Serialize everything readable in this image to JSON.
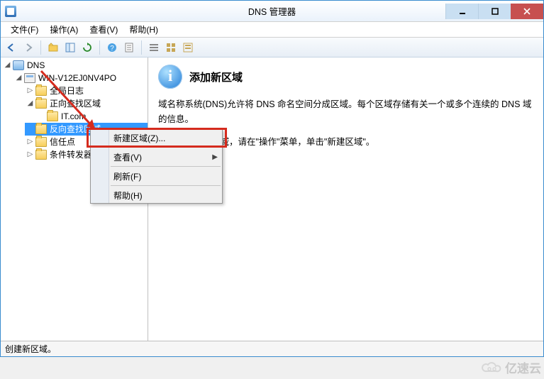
{
  "window": {
    "title": "DNS 管理器"
  },
  "menubar": {
    "file": "文件(F)",
    "action": "操作(A)",
    "view": "查看(V)",
    "help": "帮助(H)"
  },
  "toolbar_icons": {
    "back": "back-arrow-icon",
    "forward": "forward-arrow-icon",
    "up": "folder-up-icon",
    "show_hide": "show-hide-tree-icon",
    "refresh": "refresh-icon",
    "help": "help-icon",
    "properties": "properties-icon",
    "list1": "list-view-icon",
    "list2": "details-view-icon",
    "list3": "tiles-view-icon"
  },
  "tree": {
    "root": "DNS",
    "server": "WIN-V12EJ0NV4PO",
    "global_log": "全局日志",
    "fwd_zone": "正向查找区域",
    "fwd_child": "IT.com",
    "rev_zone": "反向查找区域",
    "trust": "信任点",
    "cond_fwd": "条件转发器"
  },
  "context_menu": {
    "new_zone": "新建区域(Z)...",
    "view": "查看(V)",
    "refresh": "刷新(F)",
    "help": "帮助(H)"
  },
  "content": {
    "heading": "添加新区域",
    "para1": "域名称系统(DNS)允许将 DNS 命名空间分成区域。每个区域存储有关一个或多个连续的 DNS 域的信息。",
    "para2": "要添加一个新区域，请在\"操作\"菜单，单击\"新建区域\"。"
  },
  "statusbar": {
    "text": "创建新区域。"
  },
  "watermark": {
    "text": "亿速云"
  }
}
